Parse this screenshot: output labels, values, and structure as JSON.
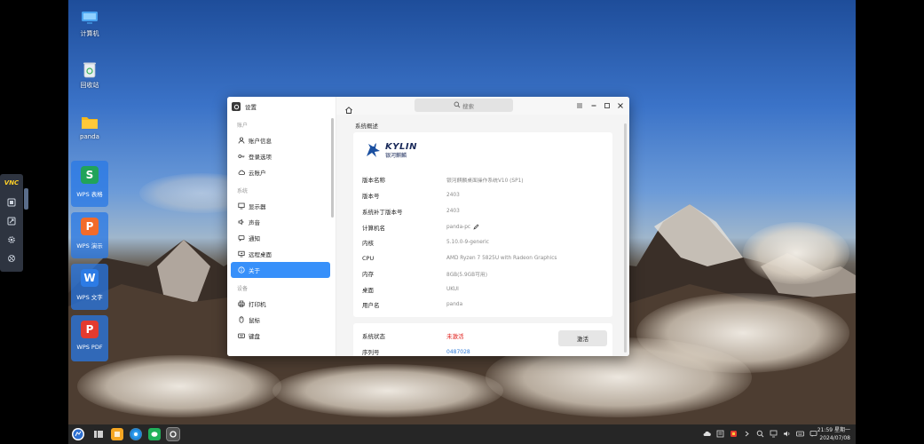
{
  "desktop": {
    "icons": [
      {
        "label": "计算机"
      },
      {
        "label": "回收站"
      },
      {
        "label": "panda"
      }
    ],
    "wps": [
      {
        "label": "WPS 表格",
        "glyph": "S",
        "color": "#21a35a"
      },
      {
        "label": "WPS 演示",
        "glyph": "P",
        "color": "#f26b2a"
      },
      {
        "label": "WPS 文字",
        "glyph": "W",
        "color": "#2c7be5"
      },
      {
        "label": "WPS PDF",
        "glyph": "P",
        "color": "#e33b2f"
      }
    ]
  },
  "vnc": {
    "logo": "VNC"
  },
  "window": {
    "app_title": "设置",
    "search_placeholder": "搜索",
    "sidebar": {
      "groups": [
        {
          "label": "账户",
          "items": [
            {
              "label": "账户信息",
              "icon": "user-icon"
            },
            {
              "label": "登录选项",
              "icon": "key-icon"
            },
            {
              "label": "云账户",
              "icon": "cloud-icon"
            }
          ]
        },
        {
          "label": "系统",
          "items": [
            {
              "label": "显示器",
              "icon": "monitor-icon"
            },
            {
              "label": "声音",
              "icon": "speaker-icon"
            },
            {
              "label": "通知",
              "icon": "notification-icon"
            },
            {
              "label": "远程桌面",
              "icon": "remote-desktop-icon"
            },
            {
              "label": "关于",
              "icon": "info-icon",
              "active": true
            }
          ]
        },
        {
          "label": "设备",
          "items": [
            {
              "label": "打印机",
              "icon": "printer-icon"
            },
            {
              "label": "鼠标",
              "icon": "mouse-icon"
            },
            {
              "label": "键盘",
              "icon": "keyboard-icon"
            }
          ]
        }
      ]
    },
    "about": {
      "section_title": "系统概述",
      "logo_en": "KYLIN",
      "logo_cn": "银河麒麟",
      "rows": [
        {
          "key": "版本名称",
          "value": "银河麒麟桌面操作系统V10 (SP1)"
        },
        {
          "key": "版本号",
          "value": "2403"
        },
        {
          "key": "系统补丁版本号",
          "value": "2403"
        },
        {
          "key": "计算机名",
          "value": "panda-pc"
        },
        {
          "key": "内核",
          "value": "5.10.0-9-generic"
        },
        {
          "key": "CPU",
          "value": "AMD Ryzen 7 5825U with Radeon Graphics"
        },
        {
          "key": "内存",
          "value": "8GB(5.9GB可用)"
        },
        {
          "key": "桌面",
          "value": "UKUI"
        },
        {
          "key": "用户名",
          "value": "panda"
        }
      ],
      "status_key": "系统状态",
      "status_value": "未激活",
      "status_color": "#e0201c",
      "serial_key": "序列号",
      "serial_value": "0487028",
      "activate_label": "激活"
    }
  },
  "taskbar": {
    "time": "21:59 星期一",
    "date": "2024/07/08"
  }
}
